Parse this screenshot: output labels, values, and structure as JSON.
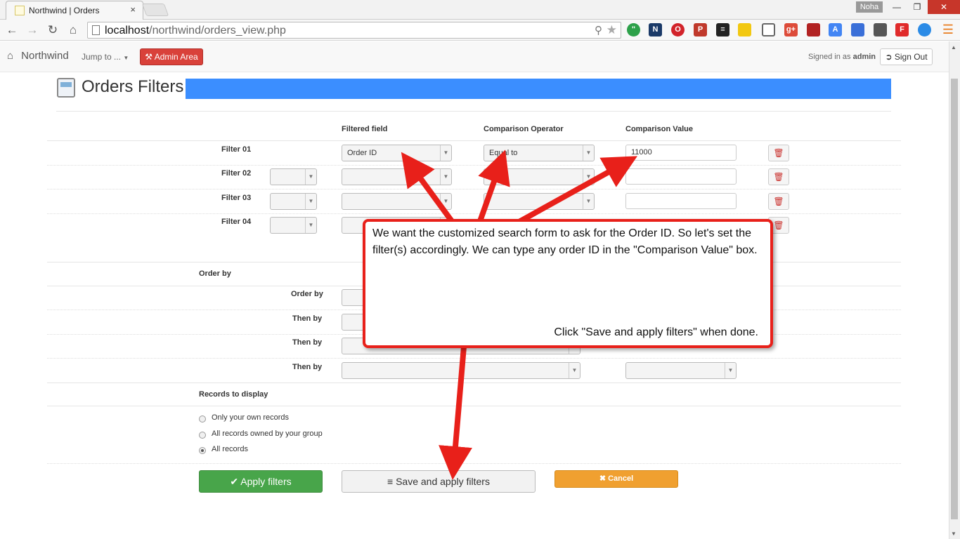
{
  "browser": {
    "tab_title": "Northwind | Orders",
    "tab_close": "×",
    "profile_name": "Noha",
    "url_host": "localhost",
    "url_path": "/northwind/orders_view.php"
  },
  "navbar": {
    "brand": "Northwind",
    "jump_menu": "Jump to ...",
    "admin_button": "Admin Area",
    "signed_in_prefix": "Signed in as",
    "signed_in_user": "admin",
    "sign_out_button": "Sign Out"
  },
  "page": {
    "title": "Orders Filters"
  },
  "filters": {
    "headers": {
      "field": "Filtered field",
      "operator": "Comparison Operator",
      "value": "Comparison Value"
    },
    "rows": [
      {
        "label": "Filter 01",
        "field": "Order ID",
        "operator": "Equal to",
        "value": "11000"
      },
      {
        "label": "Filter 02",
        "field": "",
        "operator": "",
        "value": ""
      },
      {
        "label": "Filter 03",
        "field": "",
        "operator": "",
        "value": ""
      },
      {
        "label": "Filter 04",
        "field": "",
        "operator": "",
        "value": ""
      }
    ],
    "delete_icon": "trash-icon"
  },
  "order_by": {
    "section_label": "Order by",
    "rows": [
      "Order by",
      "Then by",
      "Then by",
      "Then by"
    ]
  },
  "records": {
    "section_label": "Records to display",
    "options": [
      "Only your own records",
      "All records owned by your group",
      "All records"
    ],
    "selected_index": 2
  },
  "buttons": {
    "apply": "Apply filters",
    "save_apply": "Save and apply filters",
    "cancel": "Cancel"
  },
  "callout": {
    "text": "We want the customized search form to ask for the Order ID. So let's set the filter(s) accordingly. We can type any order ID in the \"Comparison Value\" box.",
    "hint": "Click \"Save and apply filters\" when done."
  },
  "colors": {
    "callout_border": "#e8201a",
    "title_highlight": "#3b8eff",
    "apply_green": "#48a54a",
    "cancel_orange": "#f0a030",
    "admin_red": "#d9413a"
  }
}
